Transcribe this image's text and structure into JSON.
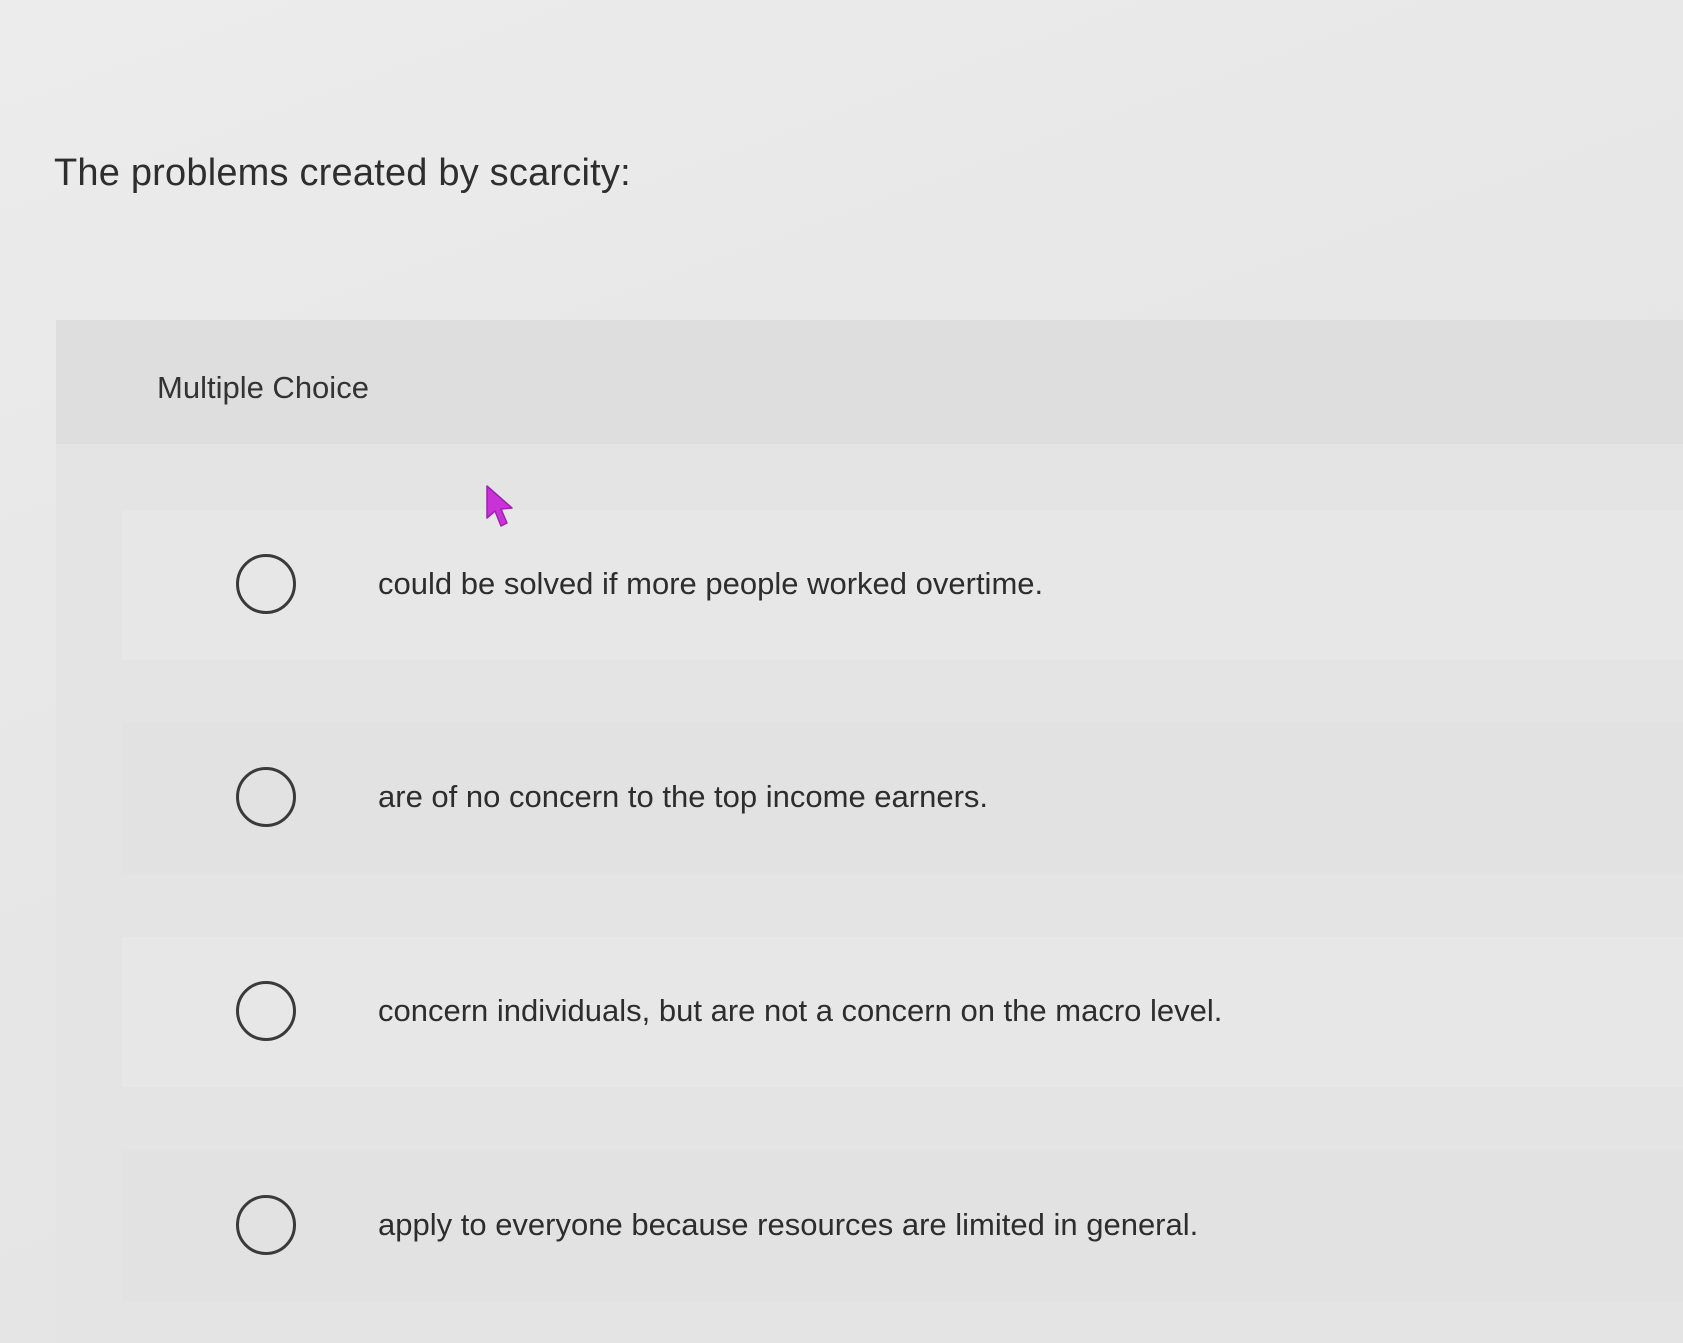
{
  "question": {
    "text": "The problems created by scarcity:"
  },
  "panel": {
    "type_label": "Multiple Choice"
  },
  "options": [
    {
      "label": "could be solved if more people worked overtime.",
      "selected": false
    },
    {
      "label": "are of no concern to the top income earners.",
      "selected": false
    },
    {
      "label": "concern individuals, but are not a concern on the macro level.",
      "selected": false
    },
    {
      "label": "apply to everyone because resources are limited in general.",
      "selected": false
    }
  ],
  "colors": {
    "cursor": "#c832d6",
    "radio_border": "#3a3a3a"
  },
  "icons": {
    "cursor": "mouse-pointer-icon",
    "radio": "radio-unchecked-icon"
  }
}
